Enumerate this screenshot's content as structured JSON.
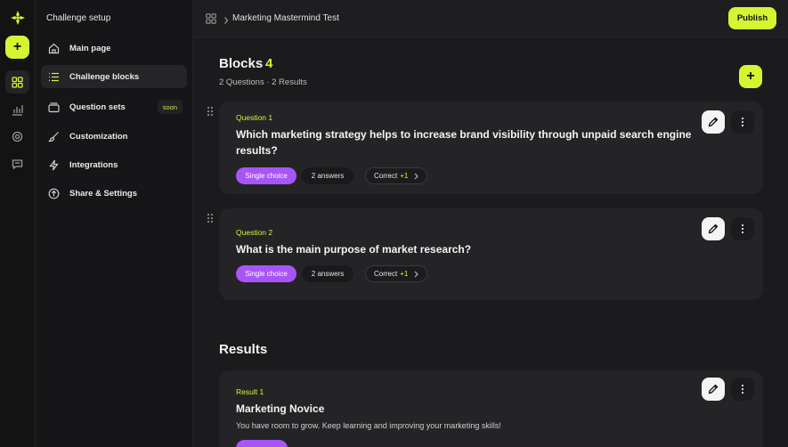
{
  "rail": {
    "add_label": "+",
    "icons": [
      "grid-icon",
      "chart-icon",
      "settings-icon",
      "chat-icon"
    ]
  },
  "sidebar": {
    "title": "Challenge setup",
    "items": [
      {
        "label": "Main page",
        "icon": "home-icon"
      },
      {
        "label": "Challenge blocks",
        "icon": "list-icon",
        "active": true
      },
      {
        "label": "Question sets",
        "icon": "stack-icon",
        "badge": "soon"
      },
      {
        "label": "Customization",
        "icon": "brush-icon"
      },
      {
        "label": "Integrations",
        "icon": "bolt-icon"
      },
      {
        "label": "Share & Settings",
        "icon": "share-icon"
      }
    ]
  },
  "topbar": {
    "breadcrumb": "Marketing Mastermind Test",
    "publish_label": "Publish"
  },
  "blocks": {
    "title": "Blocks",
    "count": "4",
    "subtitle": "2 Questions · 2 Results",
    "add_label": "+"
  },
  "questions": [
    {
      "number": "Question 1",
      "text": "Which marketing strategy helps to increase brand visibility through unpaid search engine results?",
      "type": "Single choice",
      "answers": "2 answers",
      "correct_label": "Correct",
      "correct_count": "+1"
    },
    {
      "number": "Question 2",
      "text": "What is the main purpose of market research?",
      "type": "Single choice",
      "answers": "2 answers",
      "correct_label": "Correct",
      "correct_count": "+1"
    }
  ],
  "results": {
    "title": "Results",
    "items": [
      {
        "number": "Result 1",
        "title": "Marketing Novice",
        "description": "You have room to grow. Keep learning and improving your marketing skills!"
      }
    ]
  },
  "colors": {
    "accent": "#d4f531",
    "purple": "#a855f7",
    "background": "#1b1b1d",
    "card": "#242427"
  }
}
